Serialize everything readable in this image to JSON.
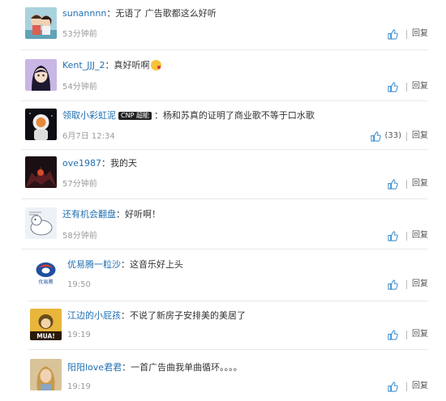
{
  "reply_label": "回复",
  "colors": {
    "username": "#1f6fb2",
    "time": "#9a9a9a",
    "like": "#3d8fd1"
  },
  "comments": [
    {
      "user": "sunannnn",
      "sep": "：",
      "text": "无语了 广告歌都这么好听",
      "time": "53分钟前",
      "likes": ""
    },
    {
      "user": "Kent_JJJ_2",
      "sep": "：",
      "text": "真好听啊",
      "time": "54分钟前",
      "likes": ""
    },
    {
      "user": "领取小彩虹泥",
      "badge": "CNP 超能",
      "sep": "：",
      "text": "杨和苏真的证明了商业歌不等于口水歌",
      "time": "6月7日 12:34",
      "likes": "(33)"
    },
    {
      "user": "ove1987",
      "sep": "：",
      "text": "我的天",
      "time": "57分钟前",
      "likes": ""
    },
    {
      "user": "还有机会翻盘",
      "sep": "：",
      "text": "好听啊！",
      "time": "58分钟前",
      "likes": ""
    },
    {
      "user": "优易腾一粒沙",
      "sep": "：",
      "text": "这音乐好上头",
      "time": "19:50",
      "likes": ""
    },
    {
      "user": "江边的小屁孩",
      "sep": "：",
      "text": "不说了新房子安排美的美居了",
      "time": "19:19",
      "likes": ""
    },
    {
      "user": "阳阳love君君",
      "sep": "：",
      "text": "一首广告曲我单曲循环。。。。",
      "time": "19:19",
      "likes": ""
    }
  ],
  "avatars": [
    {
      "icon": "cartoon-couple-avatar"
    },
    {
      "icon": "anime-girl-avatar"
    },
    {
      "icon": "astronaut-avatar"
    },
    {
      "icon": "dark-fantasy-avatar"
    },
    {
      "icon": "cartoon-drawing-avatar"
    },
    {
      "icon": "company-logo-avatar",
      "caption": "优易腾"
    },
    {
      "icon": "kiss-mua-avatar",
      "caption": "MUA!"
    },
    {
      "icon": "girl-portrait-avatar"
    }
  ]
}
